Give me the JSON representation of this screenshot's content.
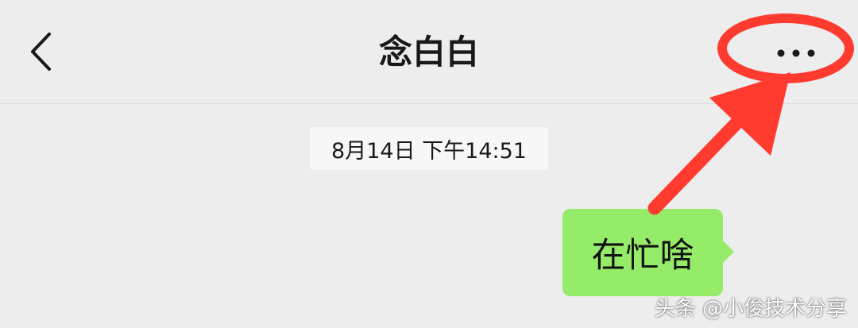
{
  "header": {
    "title": "念白白",
    "back_icon": "chevron-left-icon",
    "more_icon": "ellipsis-icon"
  },
  "chat": {
    "timestamp": "8月14日 下午14:51",
    "messages": [
      {
        "text": "在忙啥",
        "sender": "self"
      }
    ]
  },
  "watermark": "头条 @小俊技术分享",
  "colors": {
    "background": "#ededed",
    "bubble_self": "#95ec69",
    "annotation": "#ff3b30"
  }
}
